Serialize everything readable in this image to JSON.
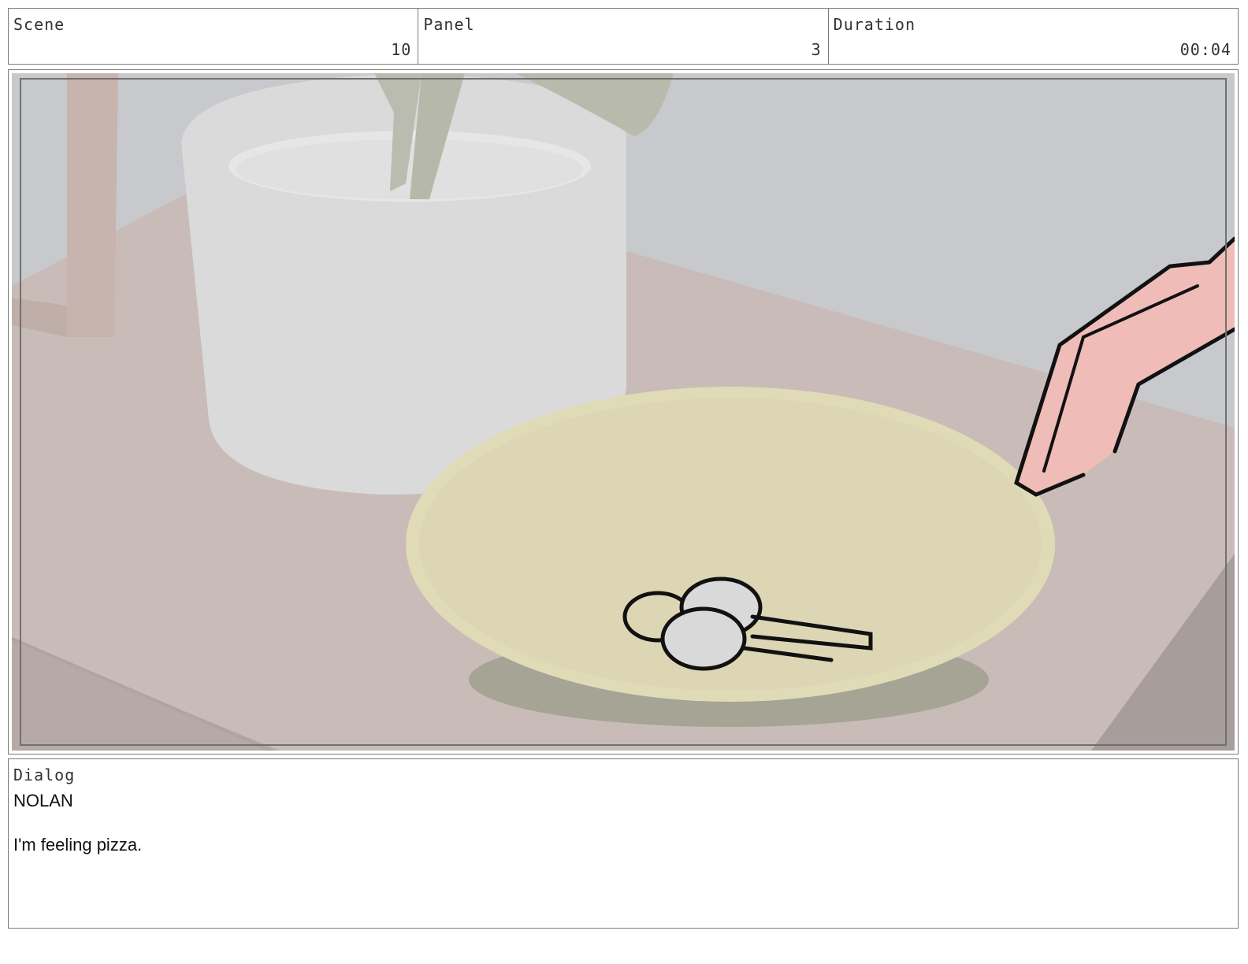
{
  "header": {
    "scene": {
      "label": "Scene",
      "value": "10"
    },
    "panel": {
      "label": "Panel",
      "value": "3"
    },
    "duration": {
      "label": "Duration",
      "value": "00:04"
    }
  },
  "dialog": {
    "label": "Dialog",
    "speaker": "NOLAN",
    "line": "I'm feeling pizza."
  },
  "colors": {
    "wall": "#c8c9cd",
    "table": "#c9bcb8",
    "pot": "#dcdcdc",
    "bowl": "#e2dcbc",
    "hand": "#efbcb8",
    "keys": "#d9d9d9"
  }
}
